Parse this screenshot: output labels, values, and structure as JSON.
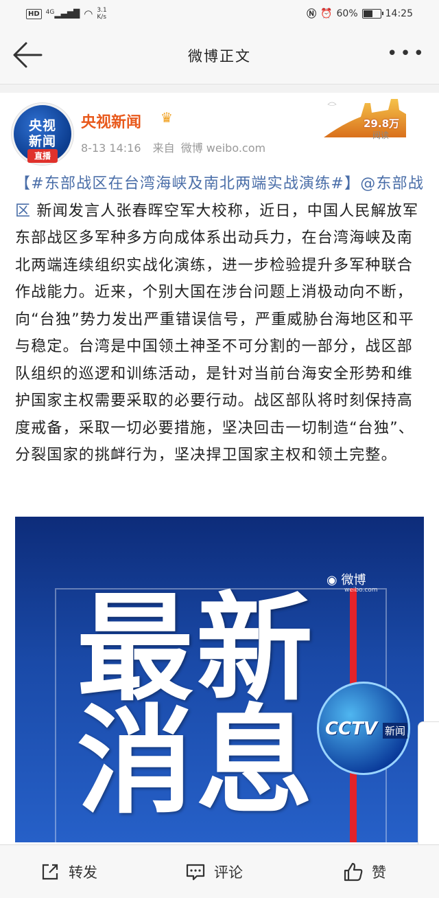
{
  "status_bar": {
    "network_badge": "HD",
    "signal": "4G",
    "net_speed": "3.1",
    "net_unit": "K/s",
    "battery": "60%",
    "battery_level": 0.6,
    "time": "14:25"
  },
  "nav": {
    "title": "微博正文",
    "more": "•••"
  },
  "post": {
    "author": {
      "name": "央视新闻",
      "avatar_line1": "央视",
      "avatar_line2": "新闻",
      "avatar_badge": "直播"
    },
    "time": "8-13 14:16",
    "source_prefix": "来自",
    "source": "微博 weibo.com",
    "read_count": "29.8万",
    "read_label": "阅读",
    "topic": "【#东部战区在台湾海峡及南北两端实战演练#】",
    "mention": "@东部战区",
    "text": " 新闻发言人张春晖空军大校称，近日，中国人民解放军东部战区多军种多方向成体系出动兵力，在台湾海峡及南北两端连续组织实战化演练，进一步检验提升多军种联合作战能力。近来，个别大国在涉台问题上消极动向不断，向“台独”势力发出严重错误信号，严重威胁台海地区和平与稳定。台湾是中国领土神圣不可分割的一部分，战区部队组织的巡逻和训练活动，是针对当前台海安全形势和维护国家主权需要采取的必要行动。战区部队将时刻保持高度戒备，采取一切必要措施，坚决回击一切制造“台独”、分裂国家的挑衅行为，坚决捍卫国家主权和领土完整。",
    "image": {
      "line1": "最新",
      "line2": "消息",
      "watermark": "微博",
      "watermark_url": "weibo.com",
      "logo": "CCTV",
      "logo_sub": "新闻"
    }
  },
  "actions": {
    "repost": "转发",
    "comment": "评论",
    "like": "赞"
  }
}
